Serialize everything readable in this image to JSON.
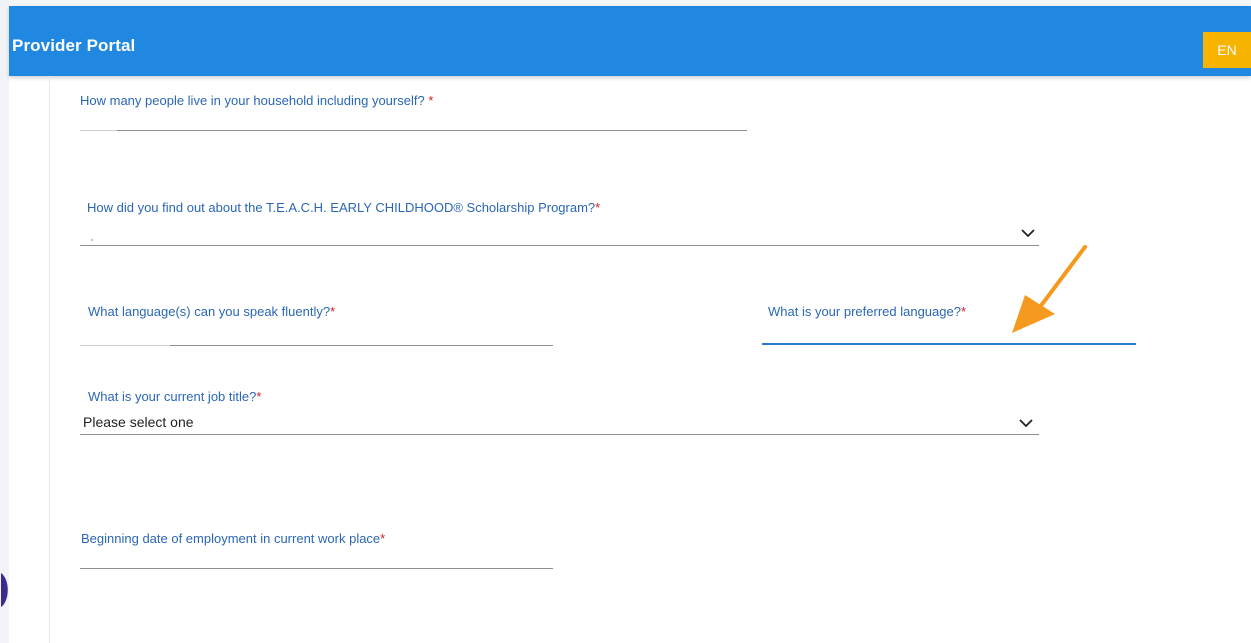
{
  "header": {
    "title": "Provider Portal",
    "language_button": "EN"
  },
  "form": {
    "household": {
      "label": "How many people live in your household including yourself?",
      "required": " *",
      "value": ""
    },
    "find_out": {
      "label": "How did you find out about the T.E.A.C.H. EARLY CHILDHOOD® Scholarship Program?",
      "required": "*",
      "value": ""
    },
    "languages_spoken": {
      "label": "What language(s) can you speak fluently?",
      "required": "*",
      "value": ""
    },
    "preferred_language": {
      "label": "What is your preferred language?",
      "required": "*",
      "value": ""
    },
    "job_title": {
      "label": "What is your current job title?",
      "required": "*",
      "value": "Please select one"
    },
    "employment_date": {
      "label": "Beginning date of employment in current work place",
      "required": "*",
      "value": ""
    }
  },
  "colors": {
    "app_bar": "#2088e0",
    "lang_button": "#f6b300",
    "label": "#2b67b4",
    "required": "#d81b1b",
    "arrow": "#f39a1f"
  },
  "icons": {
    "dropdown": "chevron-down-icon",
    "annotation": "arrow-icon"
  }
}
